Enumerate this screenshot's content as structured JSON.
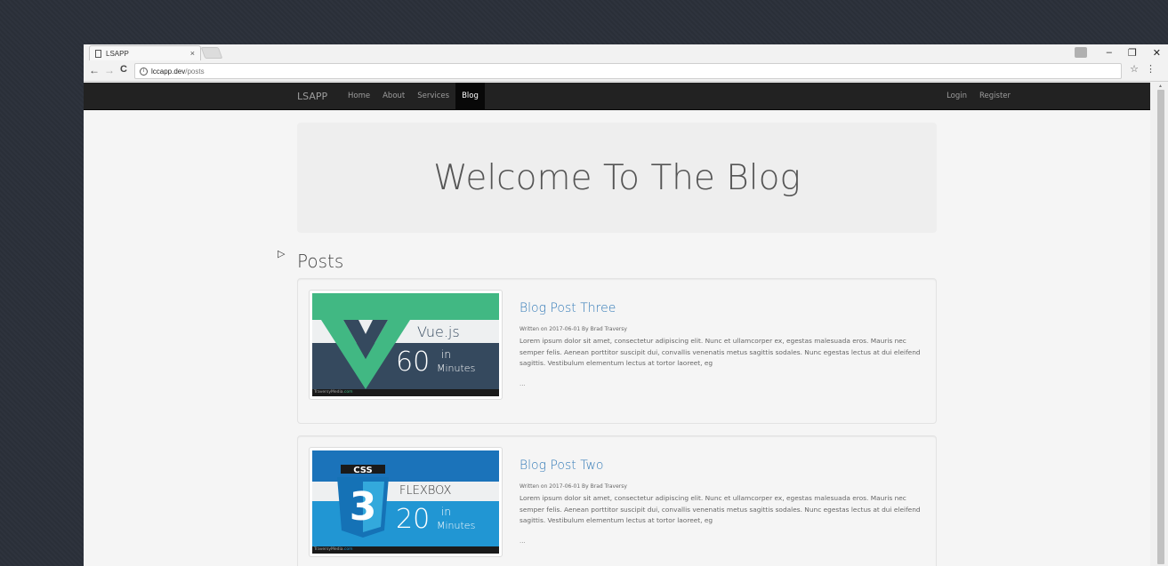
{
  "browser": {
    "tab_title": "LSAPP",
    "tab_close": "×",
    "url_host": "lccapp.dev",
    "url_path": "/posts",
    "back": "←",
    "forward": "→",
    "reload": "C",
    "star": "☆",
    "menu": "⋮",
    "minimize": "–",
    "maximize": "❐",
    "close": "✕"
  },
  "navbar": {
    "brand": "LSAPP",
    "links": [
      "Home",
      "About",
      "Services",
      "Blog"
    ],
    "active_link": "Blog",
    "right_links": [
      "Login",
      "Register"
    ]
  },
  "jumbotron": {
    "title": "Welcome To The Blog"
  },
  "posts_heading": "Posts",
  "posts": [
    {
      "title": "Blog Post Three",
      "meta": "Written on 2017-06-01 By Brad Traversy",
      "body": "Lorem ipsum dolor sit amet, consectetur adipiscing elit. Nunc et ullamcorper ex, egestas malesuada eros. Mauris nec semper felis. Aenean porttitor suscipit dui, convallis venenatis metus sagittis sodales. Nunc egestas lectus at dui eleifend sagittis. Vestibulum elementum lectus at tortor laoreet, eg",
      "ellipsis": "...",
      "thumb": {
        "name": "Vue.js",
        "number": "60",
        "in": "in",
        "unit": "Minutes",
        "footer_a": "TraversyMedia",
        "footer_b": ".com"
      }
    },
    {
      "title": "Blog Post Two",
      "meta": "Written on 2017-06-01 By Brad Traversy",
      "body": "Lorem ipsum dolor sit amet, consectetur adipiscing elit. Nunc et ullamcorper ex, egestas malesuada eros. Mauris nec semper felis. Aenean porttitor suscipit dui, convallis venenatis metus sagittis sodales. Nunc egestas lectus at dui eleifend sagittis. Vestibulum elementum lectus at tortor laoreet, eg",
      "ellipsis": "...",
      "thumb": {
        "name": "FLEXBOX",
        "badge": "CSS",
        "badge_number": "3",
        "number": "20",
        "in": "in",
        "unit": "Minutes",
        "footer_a": "TraversyMedia",
        "footer_b": ".com"
      }
    }
  ],
  "colors": {
    "navbar_bg": "#222222",
    "link_blue": "#337ab7",
    "vue_green": "#41b883",
    "vue_dark": "#35495e",
    "css_blue": "#2196d3"
  }
}
